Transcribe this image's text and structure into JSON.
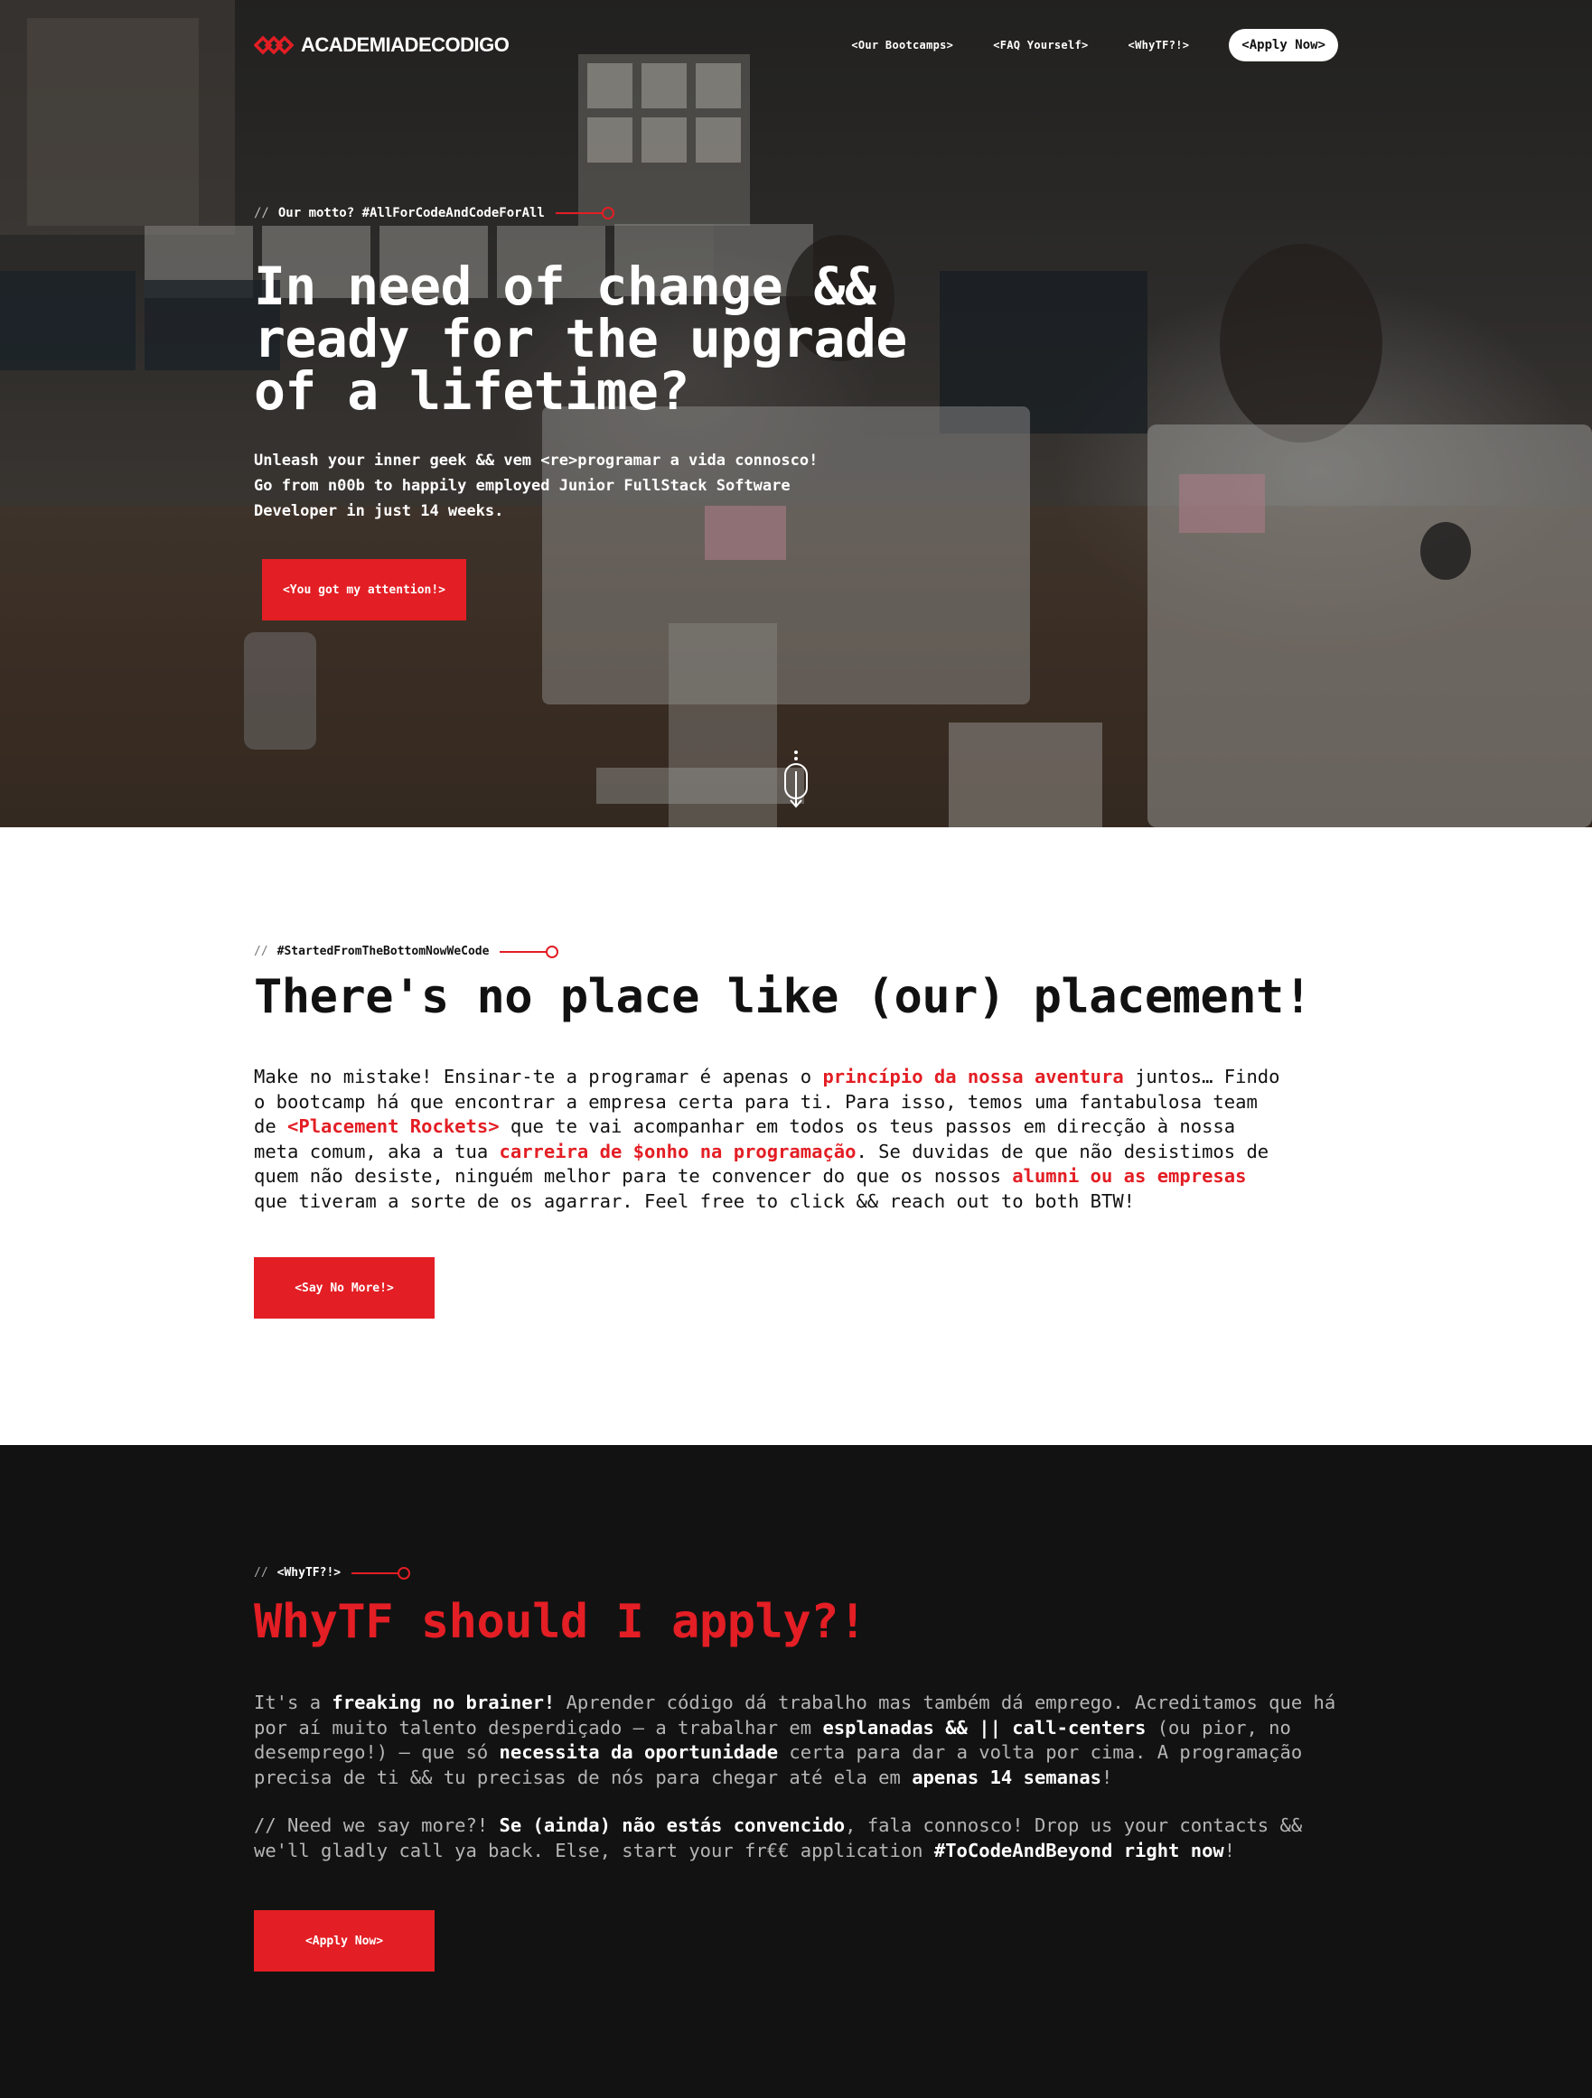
{
  "brand": {
    "logo_text": "ACADEMIADECODIGO",
    "accent_color": "#e31e24"
  },
  "nav": {
    "links": [
      "<Our Bootcamps>",
      "<FAQ Yourself>",
      "<WhyTF?!>"
    ],
    "apply_label": "<Apply Now>"
  },
  "hero": {
    "tag_prefix": "//",
    "tag": "Our motto? #AllForCodeAndCodeForAll",
    "title": "In need of change && ready for the upgrade of a lifetime?",
    "subtitle_line1": "Unleash your inner geek && vem <re>programar a vida connosco!",
    "subtitle_line2": "Go from n00b to happily employed Junior FullStack Software Developer in just 14 weeks.",
    "cta_label": "<You got my attention!>",
    "scroll_icon": "mouse-scroll-icon"
  },
  "placement": {
    "tag_prefix": "//",
    "tag": "#StartedFromTheBottomNowWeCode",
    "title": "There's no place like (our) placement!",
    "body": {
      "p1": "Make no mistake! Ensinar-te a programar é apenas o ",
      "h1": "princípio da nossa aventura",
      "p2": " juntos… Findo o bootcamp há que encontrar a empresa certa para ti. Para isso, temos uma fantabulosa team de ",
      "h2": "<Placement Rockets>",
      "p3": " que te vai acompanhar em todos os teus passos em direcção à nossa meta comum, aka a tua ",
      "h3": "carreira de $onho na programação",
      "p4": ". Se duvidas de que não desistimos de quem não desiste, ninguém melhor para te convencer do que os nossos ",
      "h4": "alumni ou as empresas",
      "p5": " que tiveram a sorte de os agarrar. Feel free to click && reach out to both BTW!"
    },
    "cta_label": "<Say No More!>"
  },
  "why": {
    "tag_prefix": "//",
    "tag": "<WhyTF?!>",
    "title": "WhyTF should I apply?!",
    "body1": {
      "p1": "It's a ",
      "b1": "freaking no brainer!",
      "p2": " Aprender código dá trabalho mas também dá emprego. Acreditamos que há por aí muito talento desperdiçado – a trabalhar em ",
      "b2": "esplanadas && || call-centers",
      "p3": " (ou pior, no desemprego!) – que só ",
      "b3": "necessita da oportunidade",
      "p4": " certa para dar a volta por cima. A programação precisa de ti && tu precisas de nós para chegar até ela em ",
      "b4": "apenas 14 semanas",
      "p5": "!"
    },
    "body2": {
      "p1": "// Need we say more?! ",
      "b1": "Se (ainda) não estás convencido",
      "p2": ", fala connosco! Drop us your contacts && we'll gladly call ya back. Else, start your fr€€ application ",
      "b2": "#ToCodeAndBeyond right now",
      "p3": "!"
    },
    "cta_label": "<Apply Now>"
  }
}
